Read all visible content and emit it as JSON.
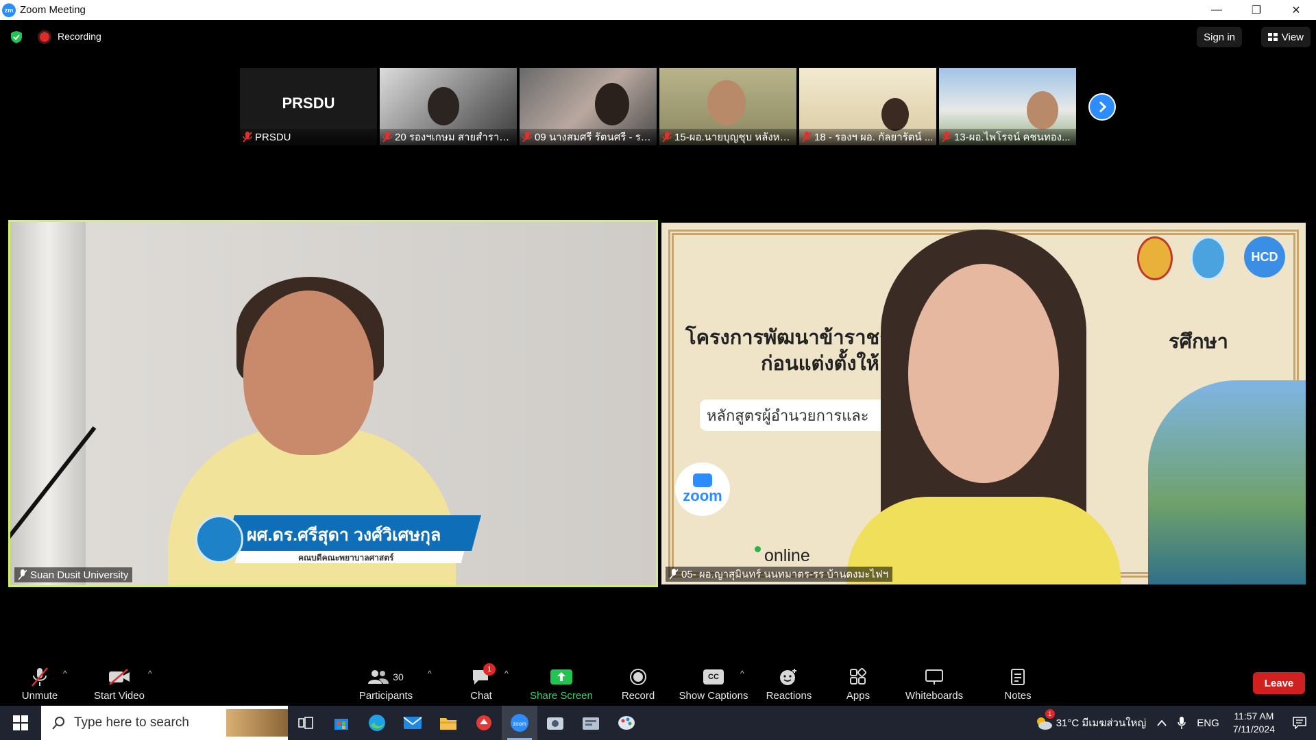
{
  "window": {
    "app_icon_text": "zm",
    "title": "Zoom Meeting",
    "minimize": "—",
    "restore": "❐",
    "close": "✕"
  },
  "meeting_bar": {
    "recording_label": "Recording",
    "sign_in": "Sign in",
    "view": "View"
  },
  "gallery_strip": [
    {
      "display": "PRSDU",
      "name": "PRSDU",
      "muted": true
    },
    {
      "name": "20 รองฯเกษม สายสำราญ...",
      "muted": true
    },
    {
      "name": "09 นางสมศรี รัตนศรี - รร....",
      "muted": true
    },
    {
      "name": "15-ผอ.นายบุญชุบ หลังหวั...",
      "muted": true
    },
    {
      "name": "18 - รองฯ ผอ. กัลยารัตน์ ...",
      "muted": true
    },
    {
      "name": "13-ผอ.ไพโรจน์ คชนทอง...",
      "muted": true
    }
  ],
  "main_video": {
    "participant_label": "Suan Dusit University",
    "banner_name": "ผศ.ดร.ศรีสุดา วงศ์วิเศษกุล",
    "banner_subtitle": "คณบดีคณะพยาบาลศาสตร์"
  },
  "second_video": {
    "participant_label": "05- ผอ.ญาสุมินทร์ นนทมาตร-รร บ้านดงมะไฟฯ",
    "slide_title_line1": "โครงการพัฒนาข้าราชก",
    "slide_title_line1_end": "รศึกษา",
    "slide_title_line2": "ก่อนแต่งตั้งให้",
    "slide_pill": "หลักสูตรผู้อำนวยการและ",
    "logo_c": "HCD",
    "zoom_word": "zoom",
    "online_word": "online"
  },
  "toolbar": {
    "unmute": "Unmute",
    "start_video": "Start Video",
    "participants": "Participants",
    "participants_count": "30",
    "chat": "Chat",
    "chat_badge": "1",
    "share_screen": "Share Screen",
    "record": "Record",
    "show_captions": "Show Captions",
    "captions_icon": "CC",
    "reactions": "Reactions",
    "apps": "Apps",
    "whiteboards": "Whiteboards",
    "notes": "Notes",
    "leave": "Leave",
    "caret": "^"
  },
  "taskbar": {
    "search_placeholder": "Type here to search",
    "weather": "31°C มีเมฆส่วนใหญ่",
    "weather_badge": "1",
    "language": "ENG",
    "time": "11:57 AM",
    "date": "7/11/2024"
  },
  "colors": {
    "zoom_blue": "#2d8cff",
    "active_speaker_border": "#d4f06a",
    "leave_red": "#d02020",
    "share_green": "#2bd36b"
  }
}
